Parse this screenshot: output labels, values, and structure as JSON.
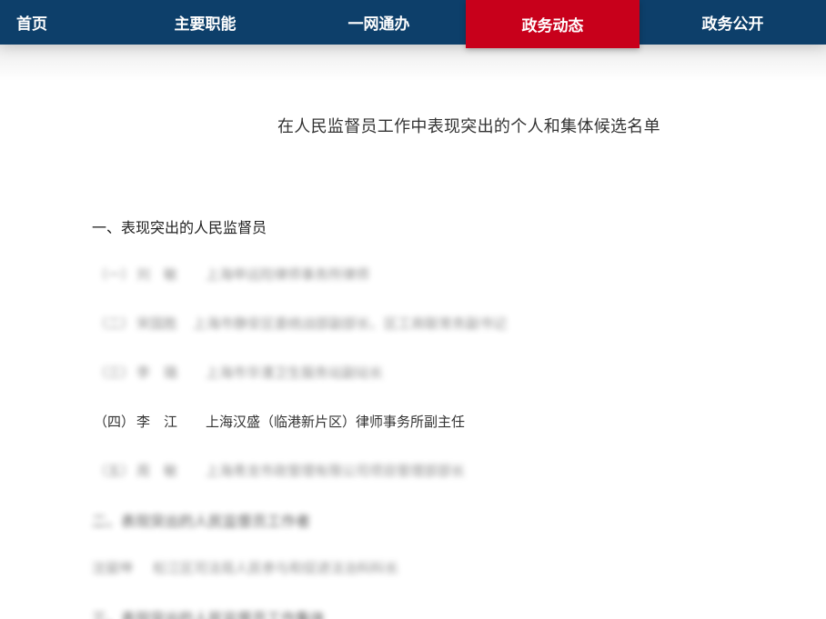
{
  "nav": {
    "items": [
      {
        "label": "首页"
      },
      {
        "label": "主要职能"
      },
      {
        "label": "一网通办"
      },
      {
        "label": "政务动态",
        "active": true
      },
      {
        "label": "政务公开"
      }
    ],
    "colors": {
      "bar": "#0d3f6a",
      "active": "#c8001b"
    }
  },
  "article": {
    "title": "在人民监督员工作中表现突出的个人和集体候选名单",
    "section1": {
      "heading": "一、表现突出的人民监督员",
      "items": [
        {
          "index": "（一）",
          "name": "刘　敏",
          "desc": "上海申远险律师事务所律师"
        },
        {
          "index": "（二）",
          "name": "宋国胜",
          "desc": "上海市静安区委统战部副部长、区工商联常务副书记"
        },
        {
          "index": "（三）",
          "name": "李　璐",
          "desc": "上海市华漕卫生服务站副站长"
        },
        {
          "index": "（四）",
          "name": "李　江",
          "desc": "上海汉盛（临港新片区）律师事务所副主任"
        },
        {
          "index": "（五）",
          "name": "周　敏",
          "desc": "上海青龙市政管理有限公司项目管理部部长"
        }
      ]
    },
    "section2": {
      "heading": "二、表现突出的人民监督员工作者",
      "line": {
        "name": "沈骏坤",
        "desc": "松江区司法局人民参与和促进法治科科长"
      }
    },
    "section3": {
      "heading": "三、表现突出的人民监督员工作集体"
    }
  }
}
